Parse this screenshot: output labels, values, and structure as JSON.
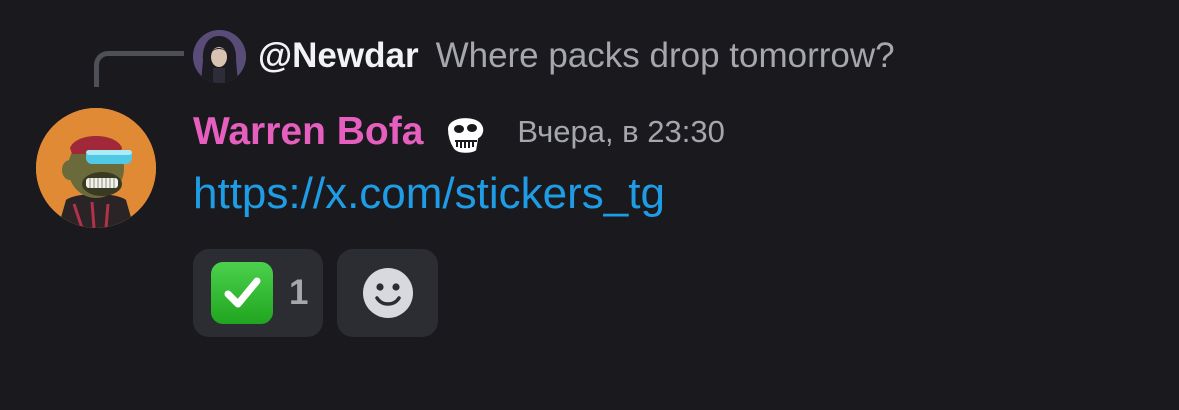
{
  "reply": {
    "author": "@Newdar",
    "text": "Where packs drop tomorrow?",
    "avatar_icon": "hooded-figure-avatar-icon"
  },
  "message": {
    "author": "Warren Bofa",
    "author_color": "#e65fbf",
    "badge_icon": "ape-skull-icon",
    "timestamp": "Вчера, в 23:30",
    "link": "https://x.com/stickers_tg",
    "link_color": "#1e9de6",
    "avatar_icon": "bored-ape-avatar-icon"
  },
  "reactions": [
    {
      "emoji_icon": "white-check-mark-icon",
      "count": "1"
    },
    {
      "emoji_icon": "add-reaction-smiley-icon"
    }
  ],
  "colors": {
    "background": "#1a1a1e",
    "reaction_background": "#2c2d33",
    "muted_text": "#a5a7ad"
  }
}
